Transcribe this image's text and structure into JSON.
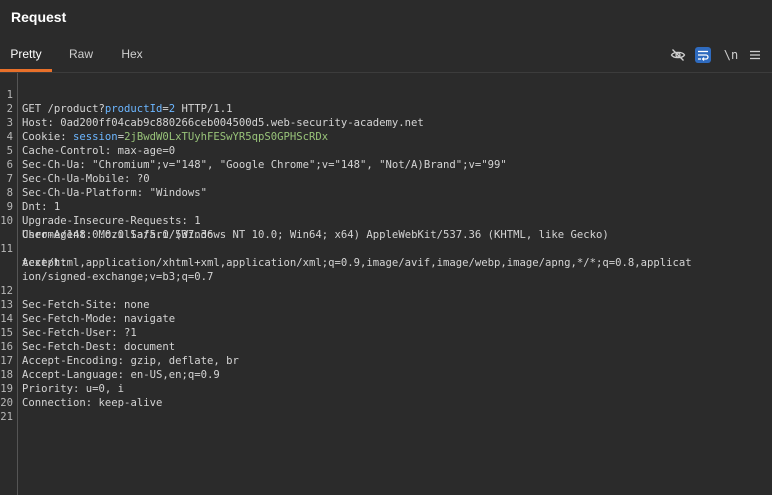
{
  "panel": {
    "title": "Request"
  },
  "tabs": [
    {
      "label": "Pretty",
      "active": true
    },
    {
      "label": "Raw",
      "active": false
    },
    {
      "label": "Hex",
      "active": false
    }
  ],
  "toolbar": {
    "newline_label": "\\n",
    "icons": [
      "eye-slash-icon",
      "wrap-text-icon",
      "newline-icon",
      "menu-icon"
    ],
    "accent_color": "#2f6bbf",
    "active_tab_color": "#e8702a"
  },
  "request": {
    "line1": {
      "method": "GET ",
      "path": "/product?",
      "param_name": "productId",
      "eq": "=",
      "param_value": "2",
      "version": " HTTP/1.1"
    },
    "line2": {
      "name": "Host:",
      "value": " 0ad200ff04cab9c880266ceb004500d5.web-security-academy.net"
    },
    "line3": {
      "name": "Cookie:",
      "cookie_name": " session",
      "eq": "=",
      "cookie_value": "2jBwdW0LxTUyhFESwYR5qpS0GPHScRDx"
    },
    "line4": {
      "name": "Cache-Control:",
      "value": " max-age=0"
    },
    "line5": {
      "name": "Sec-Ch-Ua:",
      "value": " \"Chromium\";v=\"148\", \"Google Chrome\";v=\"148\", \"Not/A)Brand\";v=\"99\""
    },
    "line6": {
      "name": "Sec-Ch-Ua-Mobile:",
      "value": " ?0"
    },
    "line7": {
      "name": "Sec-Ch-Ua-Platform:",
      "value": " \"Windows\""
    },
    "line8": {
      "name": "Dnt:",
      "value": " 1"
    },
    "line9": {
      "name": "Upgrade-Insecure-Requests:",
      "value": " 1"
    },
    "line10": {
      "name": "User-Agent:",
      "value": " Mozilla/5.0 (Windows NT 10.0; Win64; x64) AppleWebKit/537.36 (KHTML, like Gecko)",
      "cont": "Chrome/148.0.0.0 Safari/537.36"
    },
    "line11": {
      "name": "Accept:",
      "cont1": "text/html,application/xhtml+xml,application/xml;q=0.9,image/avif,image/webp,image/apng,*/*;q=0.8,applicat",
      "cont2": "ion/signed-exchange;v=b3;q=0.7"
    },
    "line12": {
      "name": "Sec-Fetch-Site:",
      "value": " none"
    },
    "line13": {
      "name": "Sec-Fetch-Mode:",
      "value": " navigate"
    },
    "line14": {
      "name": "Sec-Fetch-User:",
      "value": " ?1"
    },
    "line15": {
      "name": "Sec-Fetch-Dest:",
      "value": " document"
    },
    "line16": {
      "name": "Accept-Encoding:",
      "value": " gzip, deflate, br"
    },
    "line17": {
      "name": "Accept-Language:",
      "value": " en-US,en;q=0.9"
    },
    "line18": {
      "name": "Priority:",
      "value": " u=0, i"
    },
    "line19": {
      "name": "Connection:",
      "value": " keep-alive"
    }
  },
  "line_numbers": [
    "1",
    "2",
    "3",
    "4",
    "5",
    "6",
    "7",
    "8",
    "9",
    "10",
    "11",
    "12",
    "13",
    "14",
    "15",
    "16",
    "17",
    "18",
    "19",
    "20",
    "21"
  ]
}
